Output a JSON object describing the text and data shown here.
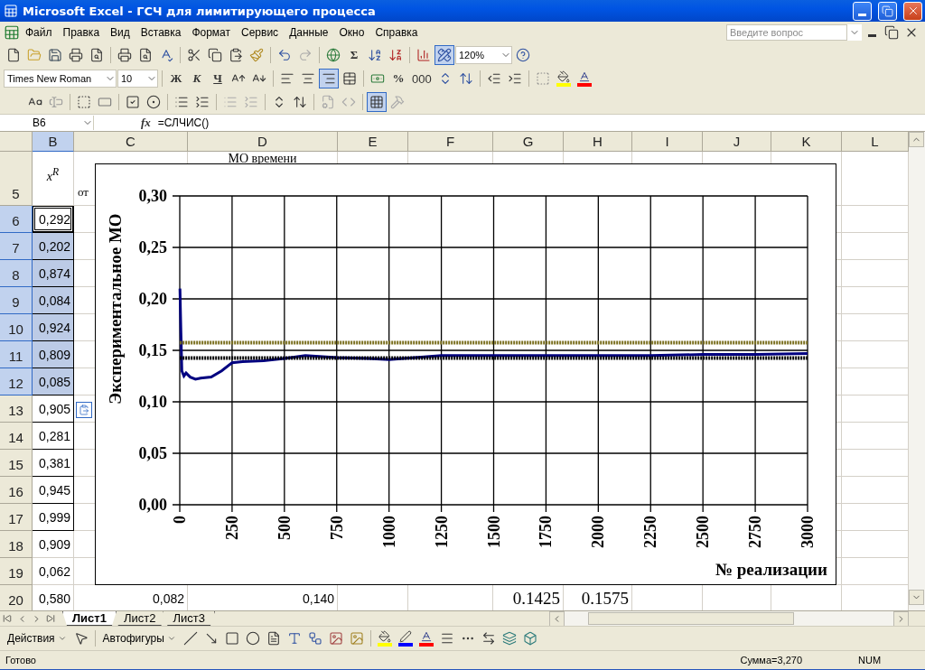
{
  "window": {
    "title": "Microsoft Excel - ГСЧ для лимитирующего процесса"
  },
  "menu": [
    "Файл",
    "Правка",
    "Вид",
    "Вставка",
    "Формат",
    "Сервис",
    "Данные",
    "Окно",
    "Справка"
  ],
  "help_box": {
    "placeholder": "Введите вопрос"
  },
  "standard_toolbar": {
    "sum_symbol": "Σ",
    "zoom": "120%",
    "drawing": {
      "on": true
    },
    "redo": {
      "disabled": true
    }
  },
  "formatting_toolbar": {
    "font": "Times New Roman",
    "size": "10",
    "bold": "Ж",
    "italic": "К",
    "underline": "Ч",
    "align_right": {
      "on": true
    },
    "percent": "%",
    "thousands": "000"
  },
  "forms_toolbar": {
    "gridlines": {
      "on": true
    }
  },
  "formula_bar": {
    "name_box": "B6",
    "fx": "fx",
    "formula": "=СЛЧИС()"
  },
  "sheet": {
    "columns": [
      {
        "label": "B",
        "selected": true
      },
      {
        "label": "C",
        "selected": false
      },
      {
        "label": "D",
        "selected": false
      },
      {
        "label": "E",
        "selected": false
      },
      {
        "label": "F",
        "selected": false
      },
      {
        "label": "G",
        "selected": false
      },
      {
        "label": "H",
        "selected": false
      },
      {
        "label": "I",
        "selected": false
      },
      {
        "label": "J",
        "selected": false
      },
      {
        "label": "K",
        "selected": false
      },
      {
        "label": "L",
        "selected": false
      }
    ],
    "rows": [
      {
        "number": "5",
        "kind": "heading",
        "selected": false,
        "active": false,
        "boxed": false,
        "cells": [
          "x$^{R}$",
          "от",
          "МО времени"
        ]
      },
      {
        "number": "6",
        "kind": "data",
        "selected": true,
        "active": true,
        "boxed": true,
        "cells": [
          "0,292"
        ]
      },
      {
        "number": "7",
        "kind": "data",
        "selected": true,
        "active": false,
        "boxed": true,
        "cells": [
          "0,202"
        ]
      },
      {
        "number": "8",
        "kind": "data",
        "selected": true,
        "active": false,
        "boxed": true,
        "cells": [
          "0,874"
        ]
      },
      {
        "number": "9",
        "kind": "data",
        "selected": true,
        "active": false,
        "boxed": true,
        "cells": [
          "0,084"
        ]
      },
      {
        "number": "10",
        "kind": "data",
        "selected": true,
        "active": false,
        "boxed": true,
        "cells": [
          "0,924"
        ]
      },
      {
        "number": "11",
        "kind": "data",
        "selected": true,
        "active": false,
        "boxed": true,
        "cells": [
          "0,809"
        ]
      },
      {
        "number": "12",
        "kind": "data",
        "selected": true,
        "active": false,
        "boxed": true,
        "cells": [
          "0,085"
        ]
      },
      {
        "number": "13",
        "kind": "data",
        "selected": false,
        "active": false,
        "boxed": true,
        "cells": [
          "0,905"
        ]
      },
      {
        "number": "14",
        "kind": "data",
        "selected": false,
        "active": false,
        "boxed": true,
        "cells": [
          "0,281"
        ]
      },
      {
        "number": "15",
        "kind": "data",
        "selected": false,
        "active": false,
        "boxed": true,
        "cells": [
          "0,381"
        ]
      },
      {
        "number": "16",
        "kind": "data",
        "selected": false,
        "active": false,
        "boxed": true,
        "cells": [
          "0,945"
        ]
      },
      {
        "number": "17",
        "kind": "data",
        "selected": false,
        "active": false,
        "boxed": true,
        "cells": [
          "0,999"
        ]
      },
      {
        "number": "18",
        "kind": "data",
        "selected": false,
        "active": false,
        "boxed": false,
        "cells": [
          "0,909"
        ]
      },
      {
        "number": "19",
        "kind": "data",
        "selected": false,
        "active": false,
        "boxed": false,
        "cells": [
          "0,062"
        ]
      },
      {
        "number": "20",
        "kind": "data",
        "selected": false,
        "active": false,
        "boxed": false,
        "cells": [
          "0,580",
          "0,082",
          "0,140",
          "",
          "",
          "0.1425",
          "0.1575"
        ]
      }
    ]
  },
  "chart": {
    "chart_data": {
      "type": "line",
      "ylabel": "Экспериментальное МО",
      "xlabel": "№ реализации",
      "x": [
        1,
        5,
        10,
        20,
        30,
        50,
        75,
        100,
        150,
        200,
        250,
        300,
        400,
        500,
        600,
        750,
        900,
        1000,
        1250,
        1500,
        1750,
        2000,
        2250,
        2500,
        2750,
        3000
      ],
      "series": [
        {
          "color": "#000080",
          "line_style": "solid",
          "values": [
            0.21,
            0.17,
            0.13,
            0.125,
            0.128,
            0.124,
            0.122,
            0.123,
            0.124,
            0.13,
            0.138,
            0.139,
            0.14,
            0.142,
            0.145,
            0.143,
            0.142,
            0.141,
            0.145,
            0.145,
            0.145,
            0.145,
            0.145,
            0.146,
            0.146,
            0.147
          ]
        },
        {
          "color": "#000000",
          "line_style": "dotted",
          "values": [
            0.1425,
            0.1425,
            0.1425,
            0.1425,
            0.1425,
            0.1425,
            0.1425,
            0.1425,
            0.1425,
            0.1425,
            0.1425,
            0.1425,
            0.1425,
            0.1425,
            0.1425,
            0.1425,
            0.1425,
            0.1425,
            0.1425,
            0.1425,
            0.1425,
            0.1425,
            0.1425,
            0.1425,
            0.1425,
            0.1425
          ]
        },
        {
          "color": "#7a6f1e",
          "line_style": "dotted",
          "values": [
            0.1575,
            0.1575,
            0.1575,
            0.1575,
            0.1575,
            0.1575,
            0.1575,
            0.1575,
            0.1575,
            0.1575,
            0.1575,
            0.1575,
            0.1575,
            0.1575,
            0.1575,
            0.1575,
            0.1575,
            0.1575,
            0.1575,
            0.1575,
            0.1575,
            0.1575,
            0.1575,
            0.1575,
            0.1575,
            0.1575
          ]
        }
      ],
      "xlim": [
        0,
        3000
      ],
      "ylim": [
        0,
        0.3
      ],
      "xticks": [
        0,
        250,
        500,
        750,
        1000,
        1250,
        1500,
        1750,
        2000,
        2250,
        2500,
        2750,
        3000
      ],
      "yticks": [
        {
          "value": 0,
          "label": "0,00"
        },
        {
          "value": 0.05,
          "label": "0,05"
        },
        {
          "value": 0.1,
          "label": "0,10"
        },
        {
          "value": 0.15,
          "label": "0,15"
        },
        {
          "value": 0.2,
          "label": "0,20"
        },
        {
          "value": 0.25,
          "label": "0,25"
        },
        {
          "value": 0.3,
          "label": "0,30"
        }
      ]
    }
  },
  "sheet_tabs": [
    {
      "label": "Лист1",
      "selected": true
    },
    {
      "label": "Лист2",
      "selected": false
    },
    {
      "label": "Лист3",
      "selected": false
    }
  ],
  "drawing_toolbar": {
    "actions": "Действия",
    "autoshapes": "Автофигуры"
  },
  "status_bar": {
    "ready": "Готово",
    "sum": "Сумма=3,270",
    "num": "NUM"
  }
}
